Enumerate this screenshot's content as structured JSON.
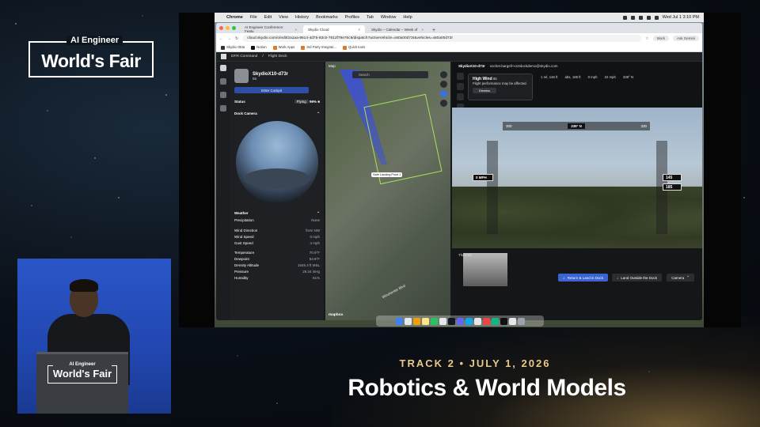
{
  "slide": {
    "brand_small": "AI Engineer",
    "brand_big": "World's Fair",
    "track_line": "TRACK 2 • JULY 1, 2026",
    "talk_title": "Robotics & World Models",
    "podium_small": "AI Engineer",
    "podium_big": "World's Fair",
    "accent_color": "#e8c98a"
  },
  "mac_menubar": {
    "apple": "",
    "app": "Chrome",
    "menus": [
      "File",
      "Edit",
      "View",
      "History",
      "Bookmarks",
      "Profiles",
      "Tab",
      "Window",
      "Help"
    ],
    "clock": "Wed Jul 1 3:10 PM"
  },
  "browser": {
    "tabs": [
      {
        "label": "AI Engineer Conference: Featu",
        "active": false
      },
      {
        "label": "Skydio Cloud",
        "active": true
      },
      {
        "label": "Skydio – Calendar – Week of",
        "active": false
      }
    ],
    "new_tab": "+",
    "url": "cloud.skydio.com/o/edit/2a1aa-8614-4d75-83c0-7612f79e76c9/dispatch?activeVehicle=x60a00d73r&vehicles=x60a00d73r",
    "ask_gemini": "Ask Gemini",
    "profile": "Work",
    "bookmarks": [
      "Skydio Okta",
      "Notion",
      "Work Apps",
      "3rd Party Integrati...",
      "Quick tools"
    ]
  },
  "app": {
    "header_left": "DFR Command",
    "header_mid": "Flight Deck",
    "drone_name": "SkydioX10-d73r",
    "drone_sub": "55",
    "enter_cockpit": "Enter Cockpit",
    "status_label": "Status",
    "status_value": "Flying",
    "battery": "96% ■",
    "dock_camera": "Dock Camera",
    "weather": "Weather",
    "weather_rows": [
      {
        "k": "Precipitation",
        "v": "None"
      },
      {
        "k": "Wind Direction",
        "v": "from NW"
      },
      {
        "k": "Wind Speed",
        "v": "0 mph"
      },
      {
        "k": "Gust Speed",
        "v": "4 mph"
      },
      {
        "k": "Temperature",
        "v": "70.9°F"
      },
      {
        "k": "Dewpoint",
        "v": "53.8°F"
      },
      {
        "k": "Density Altitude",
        "v": "1645.3 ft MSL"
      },
      {
        "k": "Pressure",
        "v": "29.34 inHg"
      },
      {
        "k": "Humidity",
        "v": "61%"
      }
    ]
  },
  "map": {
    "label": "Map",
    "search_placeholder": "Search",
    "landing_label": "Safe Landing Point 1",
    "mapbox": "mapbox",
    "street": "Winchester Blvd"
  },
  "flight": {
    "vehicle": "SkydioX10-d73r",
    "operator": "sochet.bargell+x10dockdemo@skydio.com",
    "alert_title": "High Wind",
    "alert_badge": "85",
    "alert_body": "Flight performance may be affected.",
    "dismiss": "Dismiss",
    "telemetry": [
      "1 rel, 146 ft",
      "abs, 185 ft",
      "0 mph",
      "22 mph",
      "338° N"
    ],
    "heading": "338°  N",
    "heading_left": "300",
    "heading_right": "330",
    "alt_rel": "145",
    "alt_abs": "185",
    "speed": "0 MPH",
    "thermal": "Thermal",
    "return_dock": "Return & Land in Dock",
    "land_outside": "Land Outside the Dock",
    "camera": "Camera"
  }
}
